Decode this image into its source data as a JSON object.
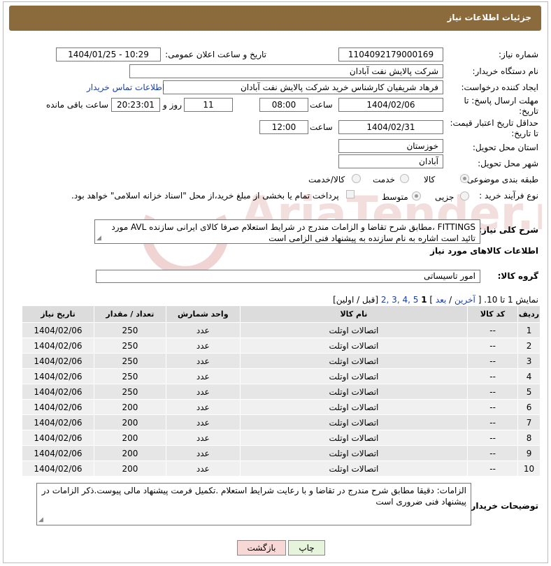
{
  "header": {
    "title": "جزئیات اطلاعات نیاز"
  },
  "fields": {
    "need_number_label": "شماره نیاز:",
    "need_number": "1104092179000169",
    "announce_label": "تاریخ و ساعت اعلان عمومی:",
    "announce_value": "1404/01/25 - 10:29",
    "buyer_org_label": "نام دستگاه خریدار:",
    "buyer_org": "شرکت پالایش نفت آبادان",
    "requester_label": "ایجاد کننده درخواست:",
    "requester": "فرهاد شریفیان کارشناس خرید شرکت پالایش نفت آبادان",
    "buyer_contact_link": "اطلاعات تماس خریدار",
    "deadline_label_1": "مهلت ارسال پاسخ: تا",
    "deadline_label_2": "تاریخ:",
    "deadline_date": "1404/02/06",
    "time_label": "ساعت",
    "deadline_time": "08:00",
    "days_value": "11",
    "days_label": "روز و",
    "remaining_time": "20:23:01",
    "remaining_label": "ساعت باقی مانده",
    "price_validity_label_1": "حداقل تاریخ اعتبار قیمت:",
    "price_validity_label_2": "تا تاریخ:",
    "price_validity_date": "1404/02/31",
    "price_validity_time": "12:00",
    "province_label": "استان محل تحویل:",
    "province": "خوزستان",
    "city_label": "شهر محل تحویل:",
    "city": "آبادان",
    "category_label": "طبقه بندی موضوعی:",
    "category_options": [
      "کالا",
      "خدمت",
      "کالا/خدمت"
    ],
    "process_label": "نوع فرآیند خرید :",
    "process_options": [
      "جزیی",
      "متوسط"
    ],
    "payment_note": "پرداخت تمام یا بخشی از مبلغ خرید،از محل \"اسناد خزانه اسلامی\" خواهد بود.",
    "general_desc_label": "شرح کلی نیاز:",
    "general_desc": "FITTINGS ،مطابق شرح تقاضا و الزامات مندرج در شرایط استعلام صرفا کالای ایرانی سازنده AVL  مورد تائید است اشاره به نام سازنده به پیشنهاد فنی الزامی است",
    "goods_info_title": "اطلاعات کالاهای مورد نیاز",
    "goods_group_label": "گروه کالا:",
    "goods_group": "امور تاسیساتی"
  },
  "pagination": {
    "showing": "نمایش 1 تا 10.",
    "open_bracket": "[",
    "last": "آخرین",
    "sep1": "/",
    "next": "بعد",
    "pages_linked": "2, 3, 4, 5",
    "current_page": "1",
    "tail": "[قبل / اولین]",
    "close_bracket": "]"
  },
  "table": {
    "headers": [
      "ردیف",
      "کد کالا",
      "نام کالا",
      "واحد شمارش",
      "تعداد / مقدار",
      "تاریخ نیاز"
    ],
    "rows": [
      [
        "1",
        "--",
        "اتصالات اوتلت",
        "عدد",
        "250",
        "1404/02/06"
      ],
      [
        "2",
        "--",
        "اتصالات اوتلت",
        "عدد",
        "250",
        "1404/02/06"
      ],
      [
        "3",
        "--",
        "اتصالات اوتلت",
        "عدد",
        "250",
        "1404/02/06"
      ],
      [
        "4",
        "--",
        "اتصالات اوتلت",
        "عدد",
        "250",
        "1404/02/06"
      ],
      [
        "5",
        "--",
        "اتصالات اوتلت",
        "عدد",
        "250",
        "1404/02/06"
      ],
      [
        "6",
        "--",
        "اتصالات اوتلت",
        "عدد",
        "200",
        "1404/02/06"
      ],
      [
        "7",
        "--",
        "اتصالات اوتلت",
        "عدد",
        "200",
        "1404/02/06"
      ],
      [
        "8",
        "--",
        "اتصالات اوتلت",
        "عدد",
        "200",
        "1404/02/06"
      ],
      [
        "9",
        "--",
        "اتصالات اوتلت",
        "عدد",
        "200",
        "1404/02/06"
      ],
      [
        "10",
        "--",
        "اتصالات اوتلت",
        "عدد",
        "200",
        "1404/02/06"
      ]
    ]
  },
  "buyer_notes": {
    "label": "توضیحات خریدار:",
    "text": "الزامات: دقیقا مطابق شرح مندرج در تقاضا و با رعایت شرایط استعلام .تکمیل فرمت پیشنهاد مالی پیوست.ذکر الزامات در پیشنهاد فنی ضروری است"
  },
  "buttons": {
    "print": "چاپ",
    "back": "بازگشت"
  },
  "watermark": {
    "text": "AriaTender.neT"
  },
  "colors": {
    "header_bg": "#8b6a3b",
    "link": "#1a3ea8",
    "back_btn": "#f8d7d7",
    "print_btn": "#e6f4dc",
    "watermark": "#f0d3d3"
  }
}
